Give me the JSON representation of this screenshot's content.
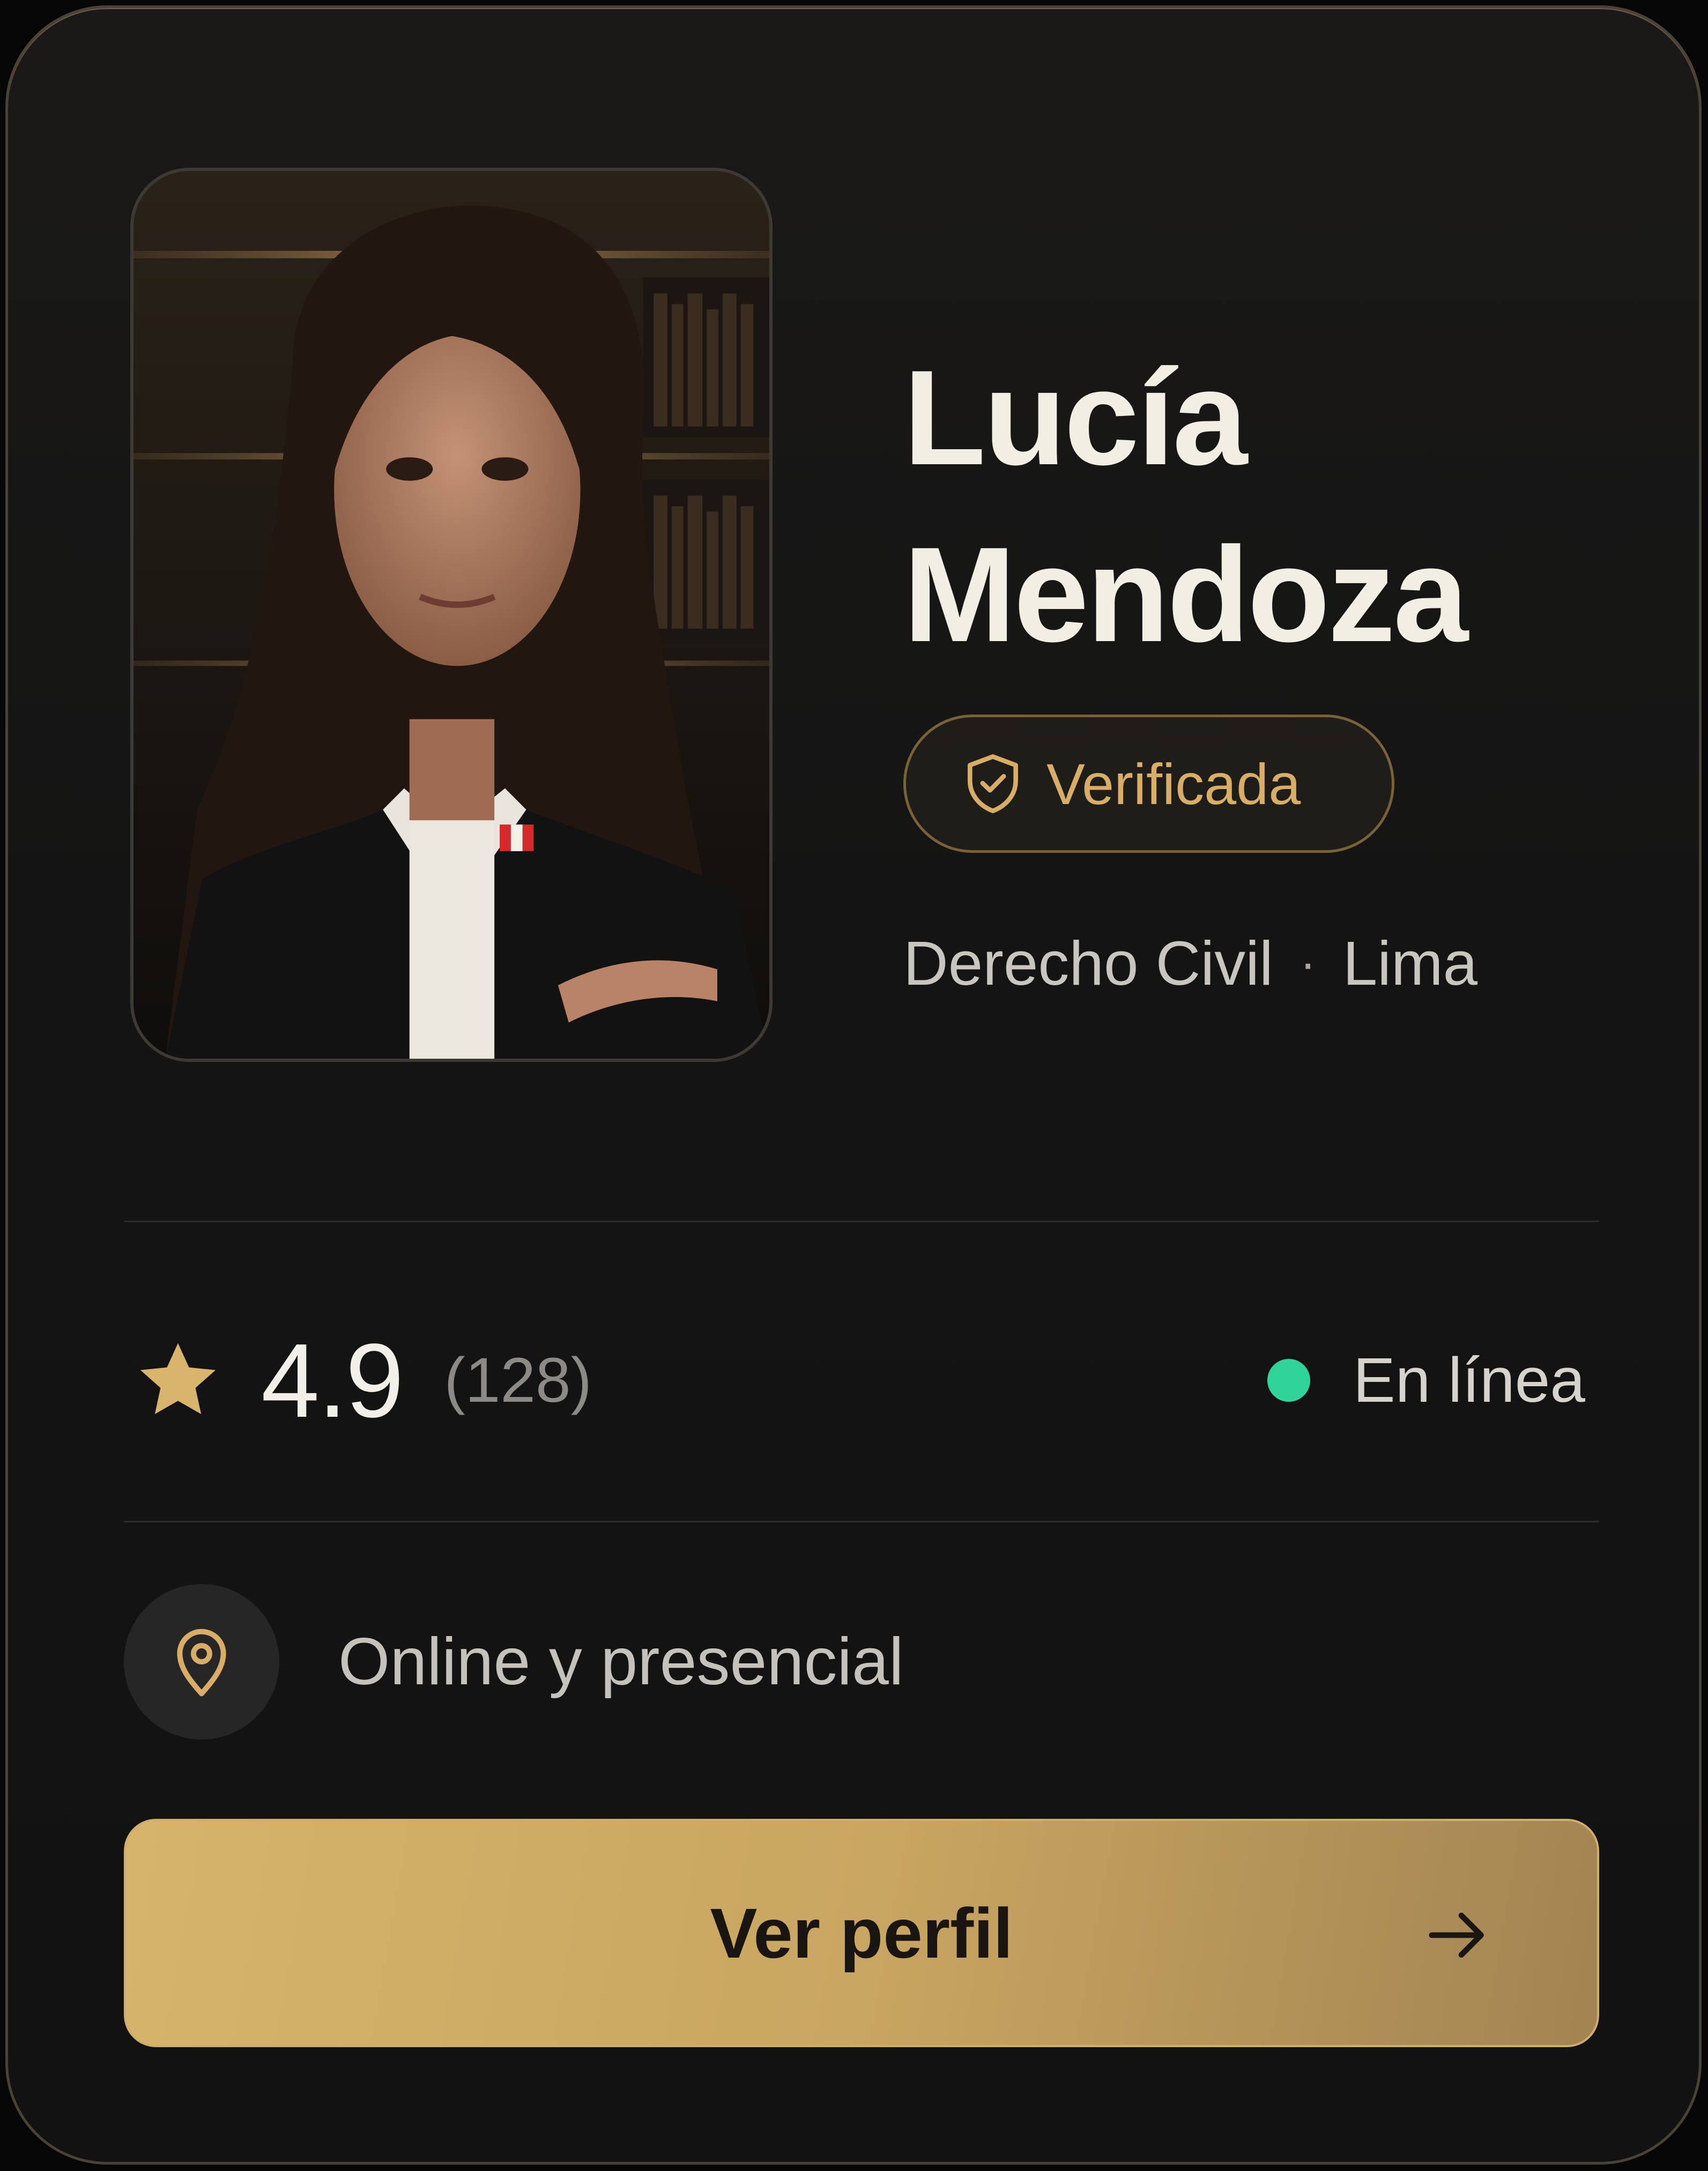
{
  "card": {
    "name_lines": [
      "Lucía",
      "Mendoza"
    ],
    "badge": {
      "label": "Verificada",
      "icon": "shield-check-icon"
    },
    "meta": {
      "specialty": "Derecho Civil",
      "separator": "·",
      "city": "Lima"
    },
    "stats": {
      "star_icon": "star-icon",
      "rating": "4.9",
      "reviews": "(128)",
      "status_label": "En línea",
      "status_color": "#2fd49a"
    },
    "mode": {
      "icon": "map-pin-icon",
      "label": "Online y presencial"
    },
    "cta": {
      "label": "Ver perfil",
      "icon": "arrow-right-icon"
    }
  },
  "colors": {
    "background": "#121212",
    "gold": "#d8ad66",
    "button_gold": "#c9a661",
    "online_green": "#2fd49a"
  }
}
